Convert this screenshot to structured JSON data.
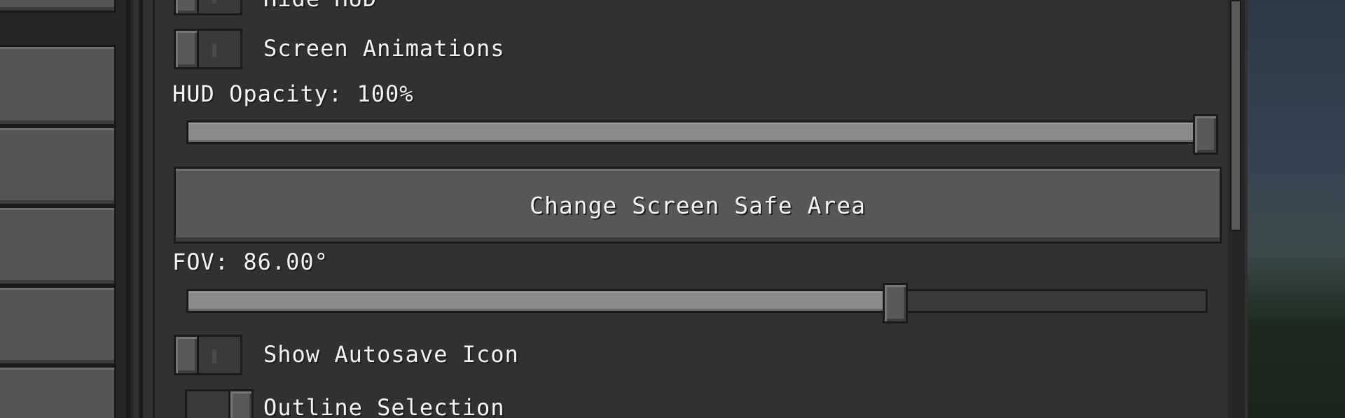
{
  "settings": {
    "hide_hud": {
      "label": "Hide HUD",
      "state": "off"
    },
    "screen_animations": {
      "label": "Screen Animations",
      "state": "off"
    },
    "hud_opacity": {
      "label": "HUD Opacity: 100%",
      "value_fraction": 1.0
    },
    "change_screen_safe_area": {
      "label": "Change Screen Safe Area"
    },
    "fov": {
      "label": "FOV: 86.00°",
      "value_fraction": 0.695
    },
    "show_autosave_icon": {
      "label": "Show Autosave Icon",
      "state": "off"
    },
    "outline_selection": {
      "label": "Outline Selection",
      "state": "on"
    }
  },
  "colors": {
    "panel_bg": "#313131",
    "text": "#f2f2f2",
    "slider_fill": "#8a8a8a",
    "border": "#1a1a1a"
  }
}
